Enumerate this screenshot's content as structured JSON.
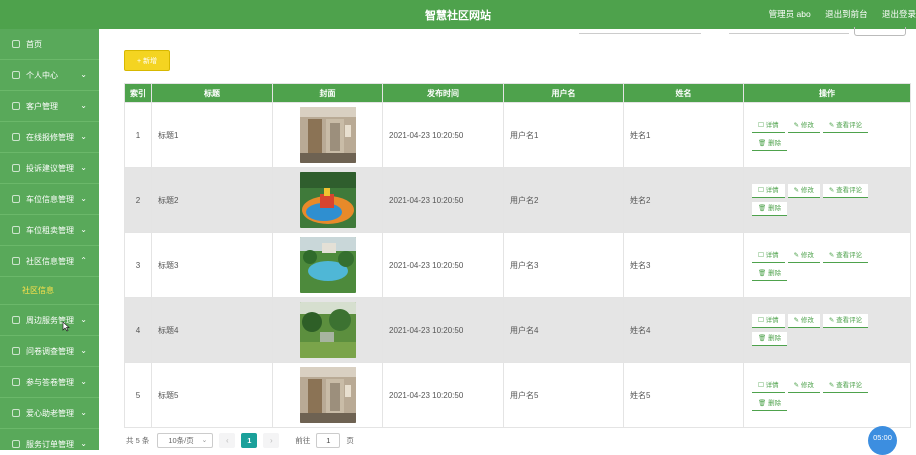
{
  "header": {
    "title": "智慧社区网站",
    "admin_label": "管理员 abo",
    "back_label": "退出到前台",
    "logout_label": "退出登录"
  },
  "sidebar": {
    "items": [
      {
        "label": "首页",
        "icon": "home-icon",
        "chevron": ""
      },
      {
        "label": "个人中心",
        "icon": "user-icon",
        "chevron": "⌄"
      },
      {
        "label": "客户管理",
        "icon": "grid-icon",
        "chevron": "⌄"
      },
      {
        "label": "在线报修管理",
        "icon": "grid-icon",
        "chevron": "⌄"
      },
      {
        "label": "投诉建议管理",
        "icon": "flag-icon",
        "chevron": "⌄"
      },
      {
        "label": "车位信息管理",
        "icon": "gear-icon",
        "chevron": "⌄"
      },
      {
        "label": "车位租卖管理",
        "icon": "doc-icon",
        "chevron": "⌄"
      },
      {
        "label": "社区信息管理",
        "icon": "doc-icon",
        "chevron": "⌃"
      }
    ],
    "submenu": {
      "label": "社区信息"
    },
    "items_after": [
      {
        "label": "周边服务管理",
        "icon": "grid-icon",
        "chevron": "⌄"
      },
      {
        "label": "问卷调查管理",
        "icon": "grid-icon",
        "chevron": "⌄"
      },
      {
        "label": "参与答卷管理",
        "icon": "gear-icon",
        "chevron": "⌄"
      },
      {
        "label": "爱心助老管理",
        "icon": "gear-icon",
        "chevron": "⌄"
      },
      {
        "label": "服务订单管理",
        "icon": "grid-icon",
        "chevron": "⌄"
      }
    ]
  },
  "toolbar": {
    "add_label": "+ 新增"
  },
  "table": {
    "headers": [
      "索引",
      "标题",
      "封面",
      "发布时间",
      "用户名",
      "姓名",
      "操作"
    ],
    "rows": [
      {
        "index": "1",
        "title": "标题1",
        "cover": "elevator-lobby",
        "time": "2021-04-23 10:20:50",
        "user": "用户名1",
        "name": "姓名1"
      },
      {
        "index": "2",
        "title": "标题2",
        "cover": "playground",
        "time": "2021-04-23 10:20:50",
        "user": "用户名2",
        "name": "姓名2"
      },
      {
        "index": "3",
        "title": "标题3",
        "cover": "pool-garden",
        "time": "2021-04-23 10:20:50",
        "user": "用户名3",
        "name": "姓名3"
      },
      {
        "index": "4",
        "title": "标题4",
        "cover": "garden",
        "time": "2021-04-23 10:20:50",
        "user": "用户名4",
        "name": "姓名4"
      },
      {
        "index": "5",
        "title": "标题5",
        "cover": "elevator-lobby",
        "time": "2021-04-23 10:20:50",
        "user": "用户名5",
        "name": "姓名5"
      }
    ],
    "actions": {
      "detail": "详情",
      "edit": "修改",
      "comments": "查看评论",
      "delete": "删除"
    }
  },
  "pager": {
    "total": "共 5 条",
    "page_size": "10条/页",
    "prev": "‹",
    "current": "1",
    "next": "›",
    "goto": "前往",
    "goto_value": "1",
    "page_unit": "页"
  },
  "timer": "05:00",
  "colors": {
    "primary": "#4ea24c",
    "sidebar": "#59a95a",
    "accent": "#f4d421",
    "active_sub": "#ffe14a",
    "page_active": "#1aa09a"
  }
}
